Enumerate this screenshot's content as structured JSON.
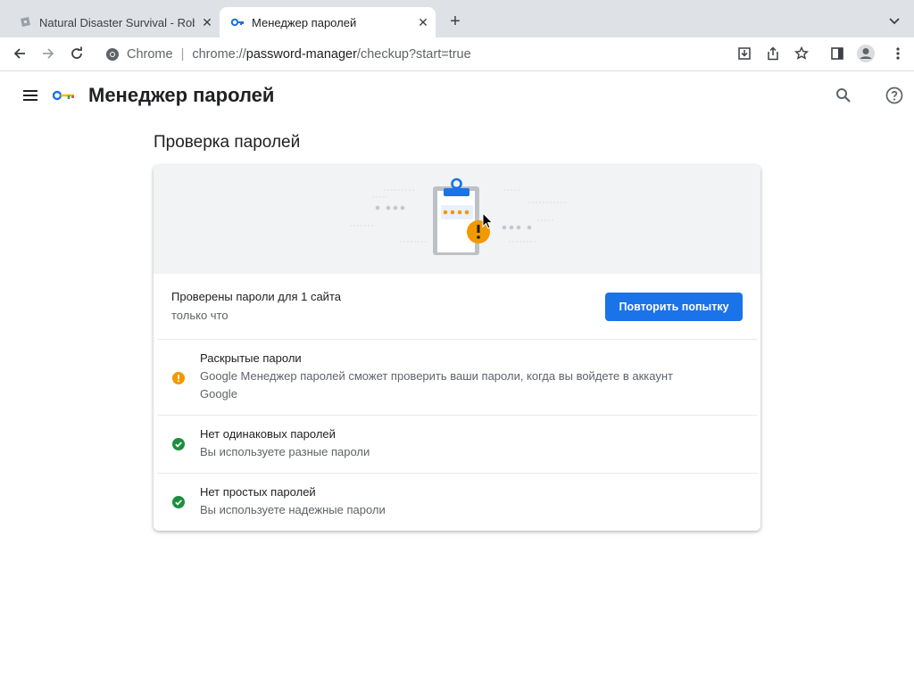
{
  "browser": {
    "tabs": [
      {
        "title": "Natural Disaster Survival - Rob",
        "active": false
      },
      {
        "title": "Менеджер паролей",
        "active": true
      }
    ],
    "omnibox": {
      "chip": "Chrome",
      "url_scheme": "chrome://",
      "url_host": "password-manager",
      "url_rest": "/checkup?start=true"
    }
  },
  "app": {
    "title": "Менеджер паролей"
  },
  "checkup": {
    "section_title": "Проверка паролей",
    "status_main": "Проверены пароли для 1 сайта",
    "status_time": "только что",
    "retry_label": "Повторить попытку",
    "items": [
      {
        "title": "Раскрытые пароли",
        "desc": "Google Менеджер паролей сможет проверить ваши пароли, когда вы войдете в аккаунт Google",
        "status": "warning"
      },
      {
        "title": "Нет одинаковых паролей",
        "desc": "Вы используете разные пароли",
        "status": "ok"
      },
      {
        "title": "Нет простых паролей",
        "desc": "Вы используете надежные пароли",
        "status": "ok"
      }
    ]
  },
  "colors": {
    "accent": "#1a73e8",
    "warning": "#f29900",
    "ok": "#1e8e3e"
  }
}
